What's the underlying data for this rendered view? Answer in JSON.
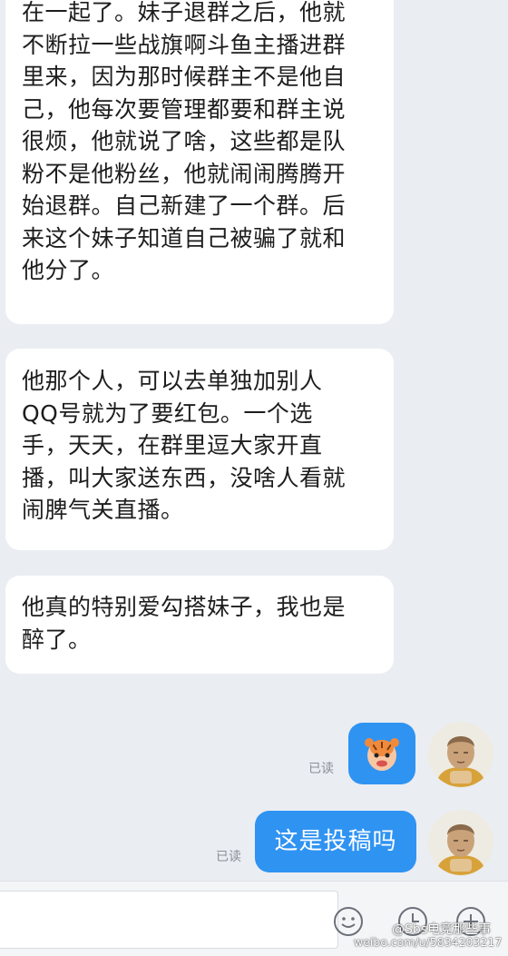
{
  "messages": {
    "m1": "在一起了。妹子退群之后，他就\n不断拉一些战旗啊斗鱼主播进群\n里来，因为那时候群主不是他自\n己，他每次要管理都要和群主说\n很烦，他就说了啥，这些都是队\n粉不是他粉丝，他就闹闹腾腾开\n始退群。自己新建了一个群。后\n来这个妹子知道自己被骗了就和\n他分了。",
    "m2": "他那个人，可以去单独加别人\nQQ号就为了要红包。一个选\n手，天天，在群里逗大家开直\n播，叫大家送东西，没啥人看就\n闹脾气关直播。",
    "m3": "他真的特别爱勾搭妹子，我也是\n醉了。",
    "sent_text": "这是投稿吗"
  },
  "status": {
    "read1": "已读",
    "read2": "已读"
  },
  "icons": {
    "sticker": "tiger-face-sticker",
    "avatar": "buddha-statue-avatar",
    "emoji": "emoji-icon",
    "clock": "clock-icon",
    "plus": "plus-icon"
  },
  "watermark": {
    "line1": "@Sbs电竞那些事",
    "line2": "weibo.com/u/5834203217"
  },
  "colors": {
    "sent_bubble": "#2f93f2",
    "background": "#eaedf2"
  }
}
